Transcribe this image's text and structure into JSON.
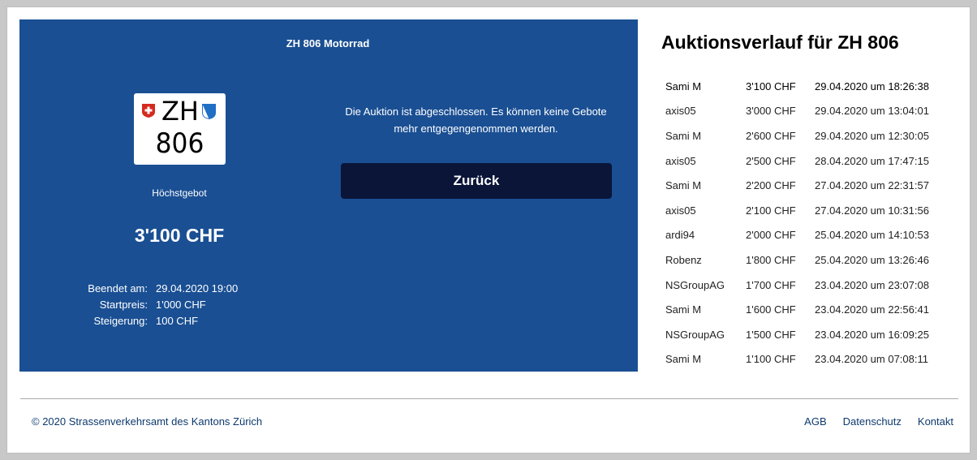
{
  "auction": {
    "title": "ZH 806 Motorrad",
    "plate": {
      "canton": "ZH",
      "number": "806"
    },
    "highest_bid_label": "Höchstgebot",
    "highest_bid_value": "3'100 CHF",
    "details": [
      {
        "label": "Beendet am:",
        "value": "29.04.2020 19:00"
      },
      {
        "label": "Startpreis:",
        "value": "1'000 CHF"
      },
      {
        "label": "Steigerung:",
        "value": "100 CHF"
      }
    ],
    "closed_message": "Die Auktion ist abgeschlossen. Es können keine Gebote mehr entgegengenommen werden.",
    "back_button_label": "Zurück",
    "colors": {
      "panel": "#1a4f93",
      "button": "#0a1538"
    }
  },
  "history": {
    "title": "Auktionsverlauf für ZH 806",
    "rows": [
      {
        "user": "Sami M",
        "amount": "3'100 CHF",
        "time": "29.04.2020 um 18:26:38"
      },
      {
        "user": "axis05",
        "amount": "3'000 CHF",
        "time": "29.04.2020 um 13:04:01"
      },
      {
        "user": "Sami M",
        "amount": "2'600 CHF",
        "time": "29.04.2020 um 12:30:05"
      },
      {
        "user": "axis05",
        "amount": "2'500 CHF",
        "time": "28.04.2020 um 17:47:15"
      },
      {
        "user": "Sami M",
        "amount": "2'200 CHF",
        "time": "27.04.2020 um 22:31:57"
      },
      {
        "user": "axis05",
        "amount": "2'100 CHF",
        "time": "27.04.2020 um 10:31:56"
      },
      {
        "user": "ardi94",
        "amount": "2'000 CHF",
        "time": "25.04.2020 um 14:10:53"
      },
      {
        "user": "Robenz",
        "amount": "1'800 CHF",
        "time": "25.04.2020 um 13:26:46"
      },
      {
        "user": "NSGroupAG",
        "amount": "1'700 CHF",
        "time": "23.04.2020 um 23:07:08"
      },
      {
        "user": "Sami M",
        "amount": "1'600 CHF",
        "time": "23.04.2020 um 22:56:41"
      },
      {
        "user": "NSGroupAG",
        "amount": "1'500 CHF",
        "time": "23.04.2020 um 16:09:25"
      },
      {
        "user": "Sami M",
        "amount": "1'100 CHF",
        "time": "23.04.2020 um 07:08:11"
      }
    ]
  },
  "footer": {
    "copyright": "© 2020 Strassenverkehrsamt des Kantons Zürich",
    "links": [
      "AGB",
      "Datenschutz",
      "Kontakt"
    ]
  },
  "icons": {
    "flag": "swiss-flag-icon",
    "shield": "zurich-shield-icon"
  }
}
